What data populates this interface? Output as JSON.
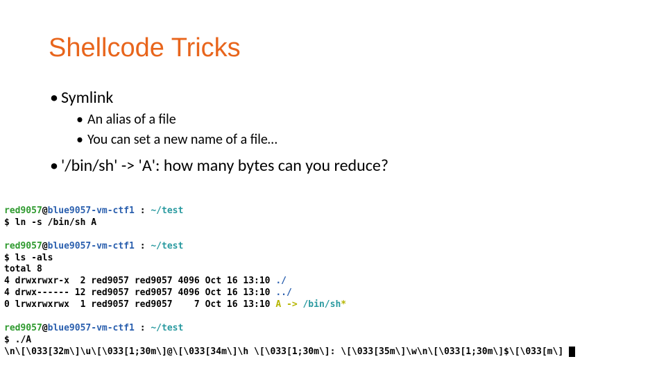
{
  "title": "Shellcode Tricks",
  "bullets": {
    "b1": "Symlink",
    "b1_1": "An alias of a file",
    "b1_2": "You can set a new name of a file…",
    "b2": "'/bin/sh' -> 'A': how many bytes can you reduce?"
  },
  "term": {
    "user": "red9057",
    "at": "@",
    "host": "blue9057-vm-ctf1 ",
    "sep": ": ",
    "cwd": "~/test",
    "ps": "$ ",
    "cmd1": "ln -s /bin/sh A",
    "cmd2": "ls -als",
    "total": "total 8",
    "row1": "4 drwxrwxr-x  2 red9057 red9057 4096 Oct 16 13:10 ",
    "row1d": "./",
    "row2": "4 drwx------ 12 red9057 red9057 4096 Oct 16 13:10 ",
    "row2d": "../",
    "row3": "0 lrwxrwxrwx  1 red9057 red9057    7 Oct 16 13:10 ",
    "row3a": "A -> ",
    "row3b": "/bin/sh",
    "row3c": "*",
    "cmd3": "./A",
    "raw": "\\n\\[\\033[32m\\]\\u\\[\\033[1;30m\\]@\\[\\033[34m\\]\\h \\[\\033[1;30m\\]: \\[\\033[35m\\]\\w\\n\\[\\033[1;30m\\]$\\[\\033[m\\] "
  }
}
